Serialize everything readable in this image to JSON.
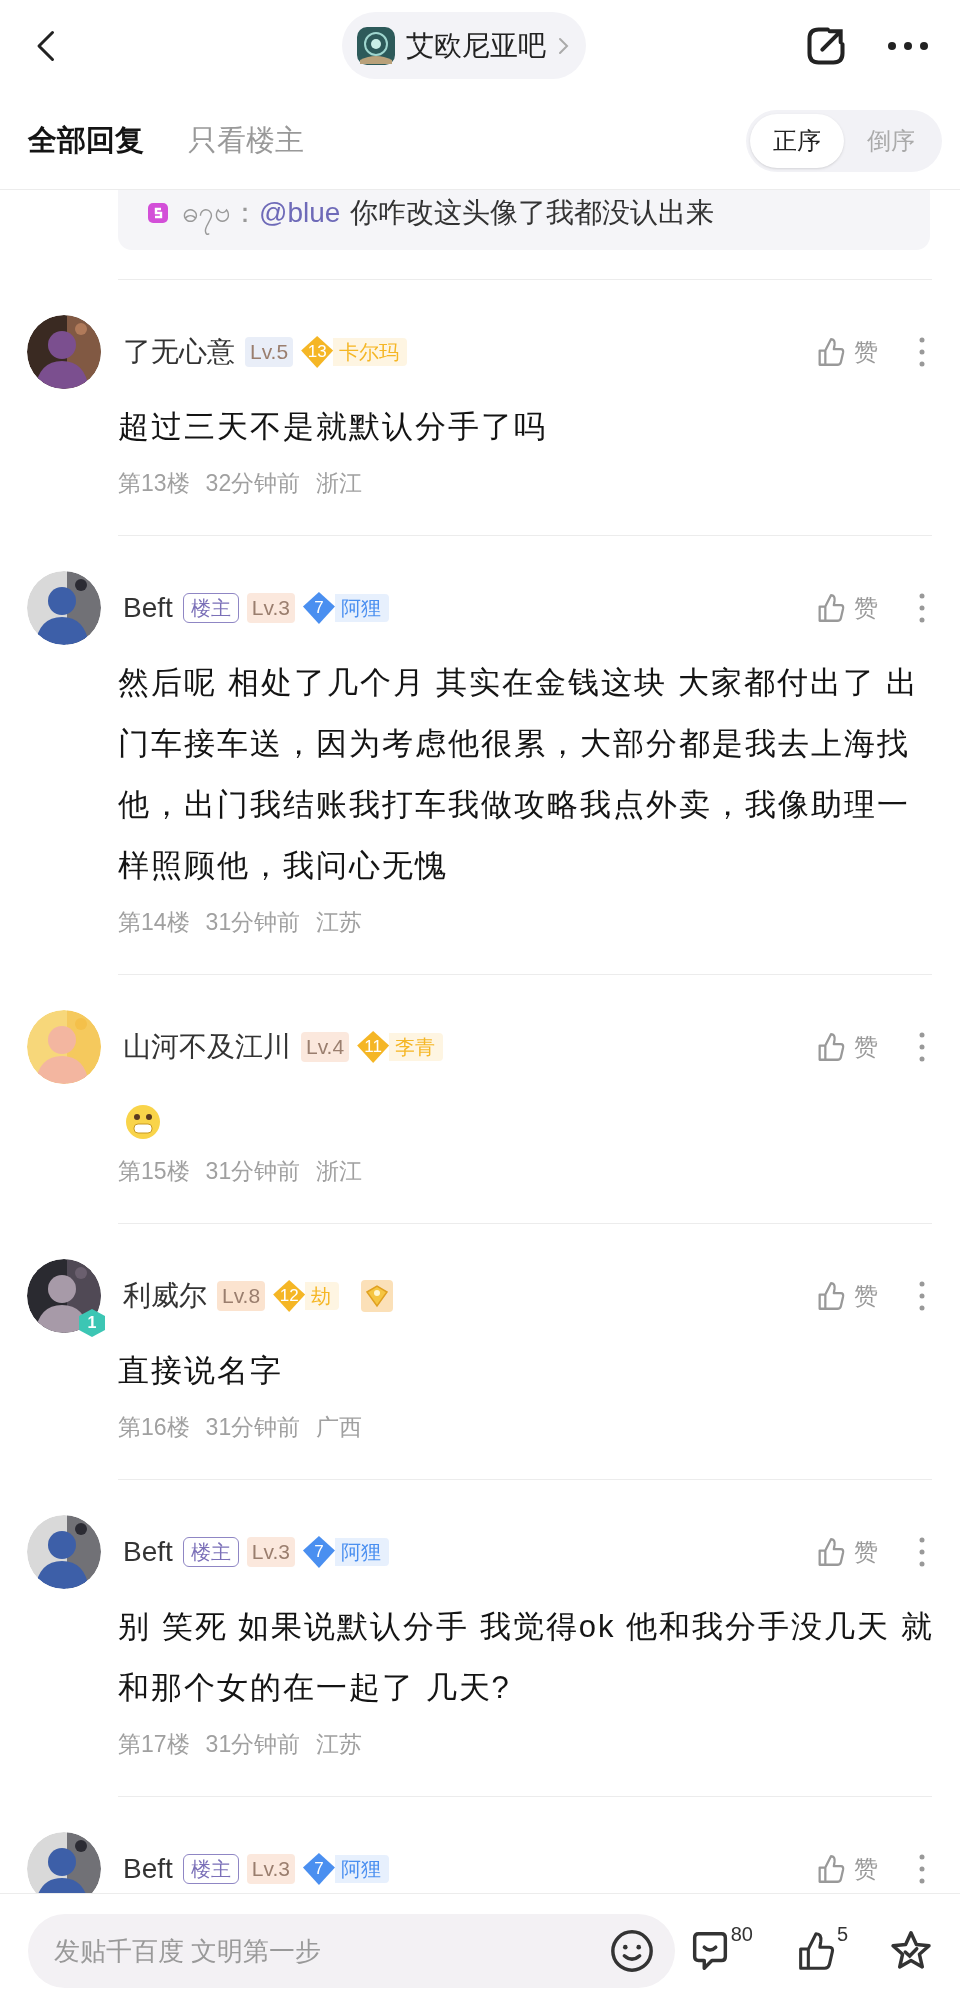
{
  "header": {
    "forum_name": "艾欧尼亚吧"
  },
  "tabs": [
    {
      "label": "全部回复",
      "selected": true
    },
    {
      "label": "只看楼主",
      "selected": false
    }
  ],
  "sort": [
    {
      "label": "正序",
      "selected": true
    },
    {
      "label": "倒序",
      "selected": false
    }
  ],
  "quoted_reply": {
    "author": "ဓ၇ဗ：",
    "mention": "@blue",
    "text": "你咋改这头像了我都没认出来"
  },
  "comments": [
    {
      "author": "了无心意",
      "badges": [
        {
          "kind": "level",
          "label": "Lv.5",
          "color": "#e9eef8"
        },
        {
          "kind": "honor",
          "number": "13",
          "title": "卡尔玛",
          "color": "#f5b625"
        }
      ],
      "body": {
        "kind": "text",
        "text": "超过三天不是就默认分手了吗"
      },
      "floor": "第13楼",
      "time": "32分钟前",
      "location": "浙江",
      "like": "赞"
    },
    {
      "author": "Beft",
      "badges": [
        {
          "kind": "owner",
          "label": "楼主"
        },
        {
          "kind": "level",
          "label": "Lv.3",
          "color": "#fbe8dd"
        },
        {
          "kind": "honor",
          "number": "7",
          "title": "阿狸",
          "color": "#4a8ff0"
        }
      ],
      "body": {
        "kind": "text",
        "text": "然后呢 相处了几个月 其实在金钱这块 大家都付出了 出门车接车送，因为考虑他很累，大部分都是我去上海找他，出门我结账我打车我做攻略我点外卖，我像助理一样照顾他，我问心无愧"
      },
      "floor": "第14楼",
      "time": "31分钟前",
      "location": "江苏",
      "like": "赞"
    },
    {
      "author": "山河不及江川",
      "badges": [
        {
          "kind": "level",
          "label": "Lv.4",
          "color": "#fbe8dd"
        },
        {
          "kind": "honor",
          "number": "11",
          "title": "李青",
          "color": "#f5b625"
        }
      ],
      "body": {
        "kind": "emoji"
      },
      "floor": "第15楼",
      "time": "31分钟前",
      "location": "浙江",
      "like": "赞"
    },
    {
      "author": "利威尔",
      "avatar_badge": "1",
      "badges": [
        {
          "kind": "level",
          "label": "Lv.8",
          "color": "#fbe3cf"
        },
        {
          "kind": "honor",
          "number": "12",
          "title": "劫",
          "color": "#f5b625"
        },
        {
          "kind": "medal"
        }
      ],
      "body": {
        "kind": "text",
        "text": "直接说名字"
      },
      "floor": "第16楼",
      "time": "31分钟前",
      "location": "广西",
      "like": "赞"
    },
    {
      "author": "Beft",
      "badges": [
        {
          "kind": "owner",
          "label": "楼主"
        },
        {
          "kind": "level",
          "label": "Lv.3",
          "color": "#fbe8dd"
        },
        {
          "kind": "honor",
          "number": "7",
          "title": "阿狸",
          "color": "#4a8ff0"
        }
      ],
      "body": {
        "kind": "text",
        "text": "别 笑死 如果说默认分手 我觉得ok 他和我分手没几天 就和那个女的在一起了 几天?"
      },
      "floor": "第17楼",
      "time": "31分钟前",
      "location": "江苏",
      "like": "赞"
    },
    {
      "author": "Beft",
      "badges": [
        {
          "kind": "owner",
          "label": "楼主"
        },
        {
          "kind": "level",
          "label": "Lv.3",
          "color": "#fbe8dd"
        },
        {
          "kind": "honor",
          "number": "7",
          "title": "阿狸",
          "color": "#4a8ff0"
        }
      ],
      "like": "赞"
    }
  ],
  "composer": {
    "placeholder": "发贴千百度 文明第一步",
    "comment_count": "80",
    "like_count": "5"
  }
}
